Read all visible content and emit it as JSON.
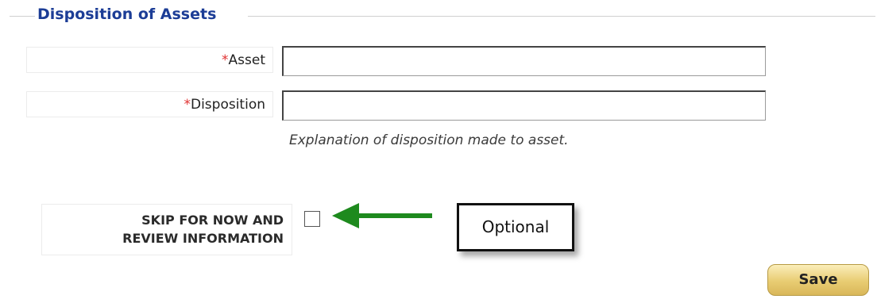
{
  "fieldset": {
    "legend": "Disposition of Assets"
  },
  "fields": {
    "asset": {
      "required_mark": "*",
      "label": "Asset",
      "value": ""
    },
    "disposition": {
      "required_mark": "*",
      "label": "Disposition",
      "value": "",
      "hint": "Explanation of disposition made to asset."
    }
  },
  "skip": {
    "label_line1": "SKIP FOR NOW AND",
    "label_line2": "REVIEW INFORMATION",
    "checked": false
  },
  "annotation": {
    "callout_text": "Optional",
    "arrow_color": "#1e8a1e"
  },
  "actions": {
    "save_label": "Save"
  },
  "colors": {
    "legend": "#1c3d96",
    "required": "#e03030",
    "save_button": "#e8cc72"
  }
}
